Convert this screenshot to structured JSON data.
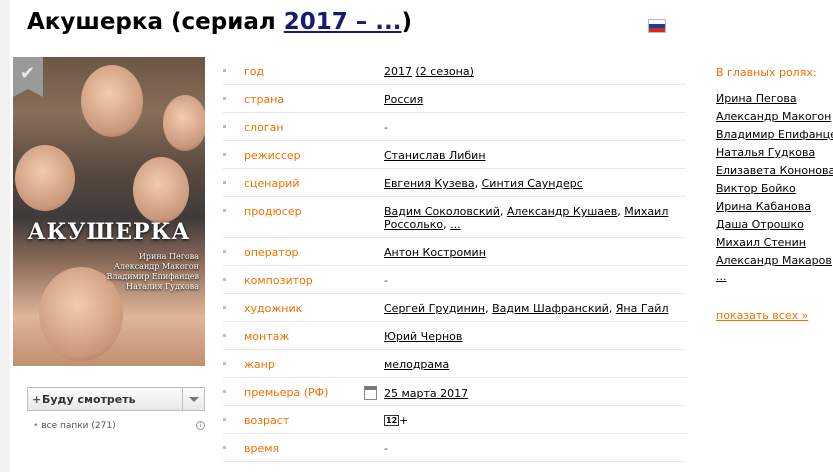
{
  "page": {
    "title_prefix": "Акушерка (сериал ",
    "title_year_link": "2017 – ...",
    "title_suffix": ")"
  },
  "flag": {
    "icon": "russia-flag-icon",
    "colors": [
      "#ffffff",
      "#1c3f9e",
      "#d52b1e"
    ]
  },
  "poster": {
    "title": "АКУШЕРКА",
    "names": [
      "Ирина Пегова",
      "Александр Макогон",
      "Владимир Епифанцев",
      "Наталия Гудкова"
    ],
    "bookmark_icon": "checkmark-icon"
  },
  "watchlist": {
    "label": "Буду смотреть",
    "folders": "все папки (271)"
  },
  "info": {
    "year_key": "год",
    "year_value": "2017",
    "year_seasons": "(2 сезона)",
    "country_key": "страна",
    "country_value": "Россия",
    "slogan_key": "слоган",
    "slogan_value": "-",
    "director_key": "режиссер",
    "director_value": "Станислав Либин",
    "writer_key": "сценарий",
    "writer_1": "Евгения Кузева",
    "writer_2": "Синтия Саундерс",
    "producer_key": "продюсер",
    "producer_1": "Вадим Соколовский",
    "producer_2": "Александр Кушаев",
    "producer_3": "Михаил Россолько",
    "producer_more": "...",
    "operator_key": "оператор",
    "operator_value": "Антон Костромин",
    "composer_key": "композитор",
    "composer_value": "-",
    "artist_key": "художник",
    "artist_1": "Сергей Грудинин",
    "artist_2": "Вадим Шафранский",
    "artist_3": "Яна Гайл",
    "editor_key": "монтаж",
    "editor_value": "Юрий Чернов",
    "genre_key": "жанр",
    "genre_value": "мелодрама",
    "premiere_key": "премьера (РФ)",
    "premiere_value": "25 марта 2017",
    "age_key": "возраст",
    "age_value": "12",
    "age_plus": "+",
    "time_key": "время",
    "time_value": "-"
  },
  "roles": {
    "heading": "В главных ролях:",
    "actors": [
      "Ирина Пегова",
      "Александр Макогон",
      "Владимир Епифанцев",
      "Наталья Гудкова",
      "Елизавета Кононова",
      "Виктор Бойко",
      "Ирина Кабанова",
      "Даша Отрошко",
      "Михаил Стенин",
      "Александр Макаров"
    ],
    "more": "...",
    "show_all": "показать всех »"
  },
  "colors": {
    "accent": "#f07000",
    "title_link": "#1a1a6e"
  }
}
